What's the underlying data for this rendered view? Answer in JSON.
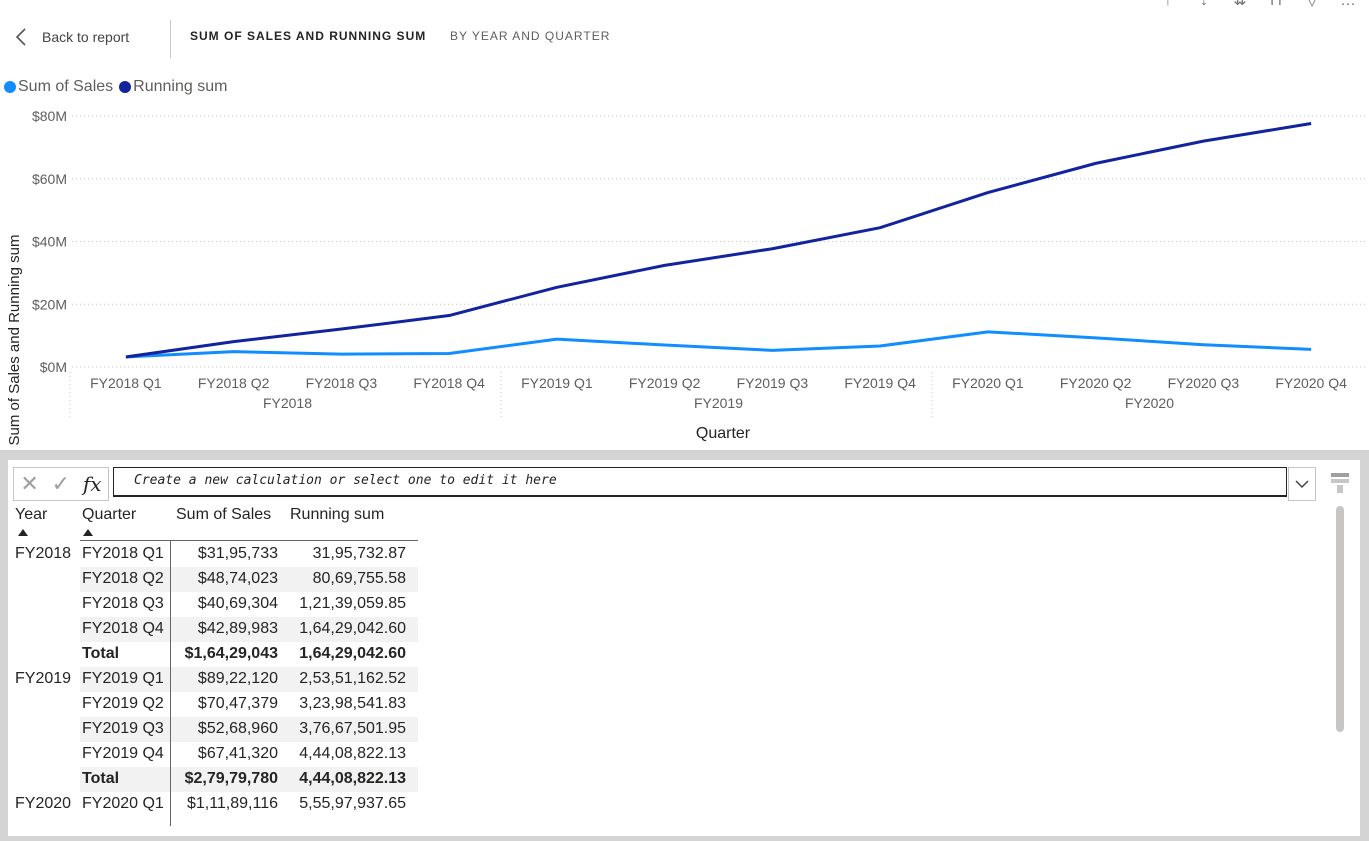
{
  "header": {
    "back_label": "Back to report",
    "title": "SUM OF SALES AND RUNNING SUM",
    "subtitle": "BY YEAR AND QUARTER"
  },
  "colors": {
    "sales": "#118DFF",
    "running": "#12239E"
  },
  "legend": [
    {
      "label": "Sum of Sales",
      "color": "#118DFF"
    },
    {
      "label": "Running sum",
      "color": "#12239E"
    }
  ],
  "chart_data": {
    "type": "line",
    "xlabel": "Quarter",
    "ylabel": "Sum of Sales and Running sum",
    "yticks": [
      "$80M",
      "$60M",
      "$40M",
      "$20M",
      "$0M"
    ],
    "ylim": [
      0,
      80
    ],
    "y_unit": "M",
    "categories": [
      "FY2018 Q1",
      "FY2018 Q2",
      "FY2018 Q3",
      "FY2018 Q4",
      "FY2019 Q1",
      "FY2019 Q2",
      "FY2019 Q3",
      "FY2019 Q4",
      "FY2020 Q1",
      "FY2020 Q2",
      "FY2020 Q3",
      "FY2020 Q4"
    ],
    "groups": [
      "FY2018",
      "FY2019",
      "FY2020"
    ],
    "series": [
      {
        "name": "Sum of Sales",
        "values": [
          3.2,
          4.9,
          4.1,
          4.3,
          8.9,
          7.0,
          5.3,
          6.7,
          11.2,
          9.3,
          7.1,
          5.6
        ]
      },
      {
        "name": "Running sum",
        "values": [
          3.2,
          8.1,
          12.1,
          16.4,
          25.4,
          32.4,
          37.7,
          44.4,
          55.6,
          64.9,
          72.0,
          77.6
        ]
      }
    ],
    "grid": true,
    "legend_position": "top-left"
  },
  "formula_bar": {
    "placeholder": "Create a new calculation or select one to edit it here"
  },
  "table": {
    "columns": [
      "Year",
      "Quarter",
      "Sum of Sales",
      "Running sum"
    ],
    "rows": [
      {
        "year": "FY2018",
        "quarter": "FY2018 Q1",
        "sales": "$31,95,733",
        "running": "31,95,732.87",
        "total": false
      },
      {
        "year": "",
        "quarter": "FY2018 Q2",
        "sales": "$48,74,023",
        "running": "80,69,755.58",
        "total": false
      },
      {
        "year": "",
        "quarter": "FY2018 Q3",
        "sales": "$40,69,304",
        "running": "1,21,39,059.85",
        "total": false
      },
      {
        "year": "",
        "quarter": "FY2018 Q4",
        "sales": "$42,89,983",
        "running": "1,64,29,042.60",
        "total": false
      },
      {
        "year": "",
        "quarter": "Total",
        "sales": "$1,64,29,043",
        "running": "1,64,29,042.60",
        "total": true
      },
      {
        "year": "FY2019",
        "quarter": "FY2019 Q1",
        "sales": "$89,22,120",
        "running": "2,53,51,162.52",
        "total": false
      },
      {
        "year": "",
        "quarter": "FY2019 Q2",
        "sales": "$70,47,379",
        "running": "3,23,98,541.83",
        "total": false
      },
      {
        "year": "",
        "quarter": "FY2019 Q3",
        "sales": "$52,68,960",
        "running": "3,76,67,501.95",
        "total": false
      },
      {
        "year": "",
        "quarter": "FY2019 Q4",
        "sales": "$67,41,320",
        "running": "4,44,08,822.13",
        "total": false
      },
      {
        "year": "",
        "quarter": "Total",
        "sales": "$2,79,79,780",
        "running": "4,44,08,822.13",
        "total": true
      },
      {
        "year": "FY2020",
        "quarter": "FY2020 Q1",
        "sales": "$1,11,89,116",
        "running": "5,55,97,937.65",
        "total": false
      }
    ]
  }
}
